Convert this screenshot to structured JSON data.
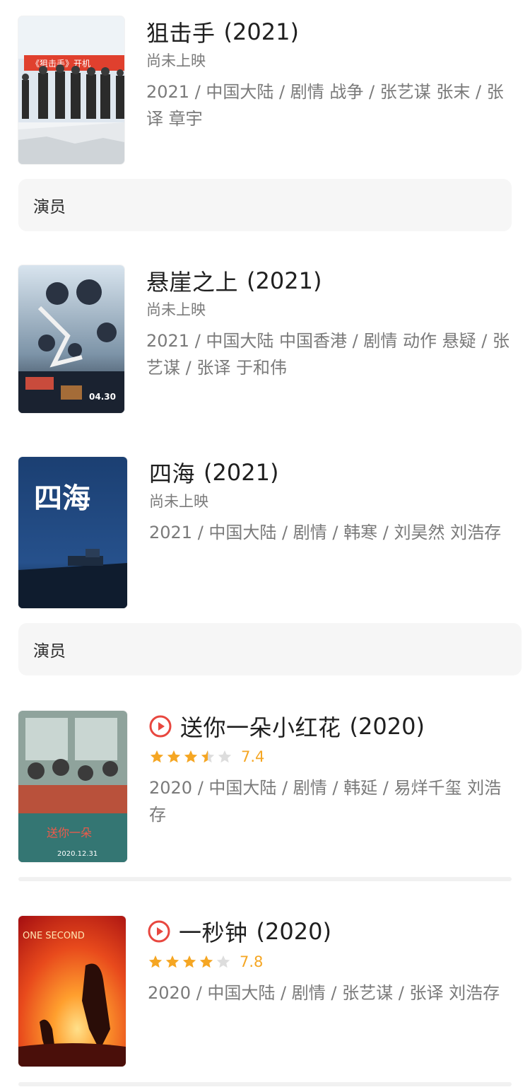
{
  "movies": [
    {
      "title": "狙击手",
      "year": "(2021)",
      "status": "尚未上映",
      "meta": "2021 / 中国大陆 / 剧情 战争 / 张艺谋 张末 / 张译 章宇",
      "poster_text": "《狙击手》开机"
    },
    {
      "title": "悬崖之上",
      "year": "(2021)",
      "status": "尚未上映",
      "meta": "2021 / 中国大陆 中国香港 / 剧情 动作 悬疑 / 张艺谋 / 张译 于和伟",
      "poster_text": "04.30"
    },
    {
      "title": "四海",
      "year": "(2021)",
      "status": "尚未上映",
      "meta": "2021 / 中国大陆 / 剧情 / 韩寒 / 刘昊然 刘浩存",
      "poster_text": "四海"
    },
    {
      "title": "送你一朵小红花",
      "year": "(2020)",
      "rating": 3.5,
      "score": "7.4",
      "meta": "2020 / 中国大陆 / 剧情 / 韩延 / 易烊千玺 刘浩存",
      "poster_text": "2020.12.31"
    },
    {
      "title": "一秒钟",
      "year": "(2020)",
      "rating": 4,
      "score": "7.8",
      "meta": "2020 / 中国大陆 / 剧情 / 张艺谋 / 张译 刘浩存",
      "poster_text": "ONE SECOND"
    }
  ],
  "cast_bars": [
    "演员",
    "演员"
  ],
  "colors": {
    "accent_red": "#e8473f",
    "star_gold": "#f5a623",
    "star_empty": "#dddddd"
  }
}
